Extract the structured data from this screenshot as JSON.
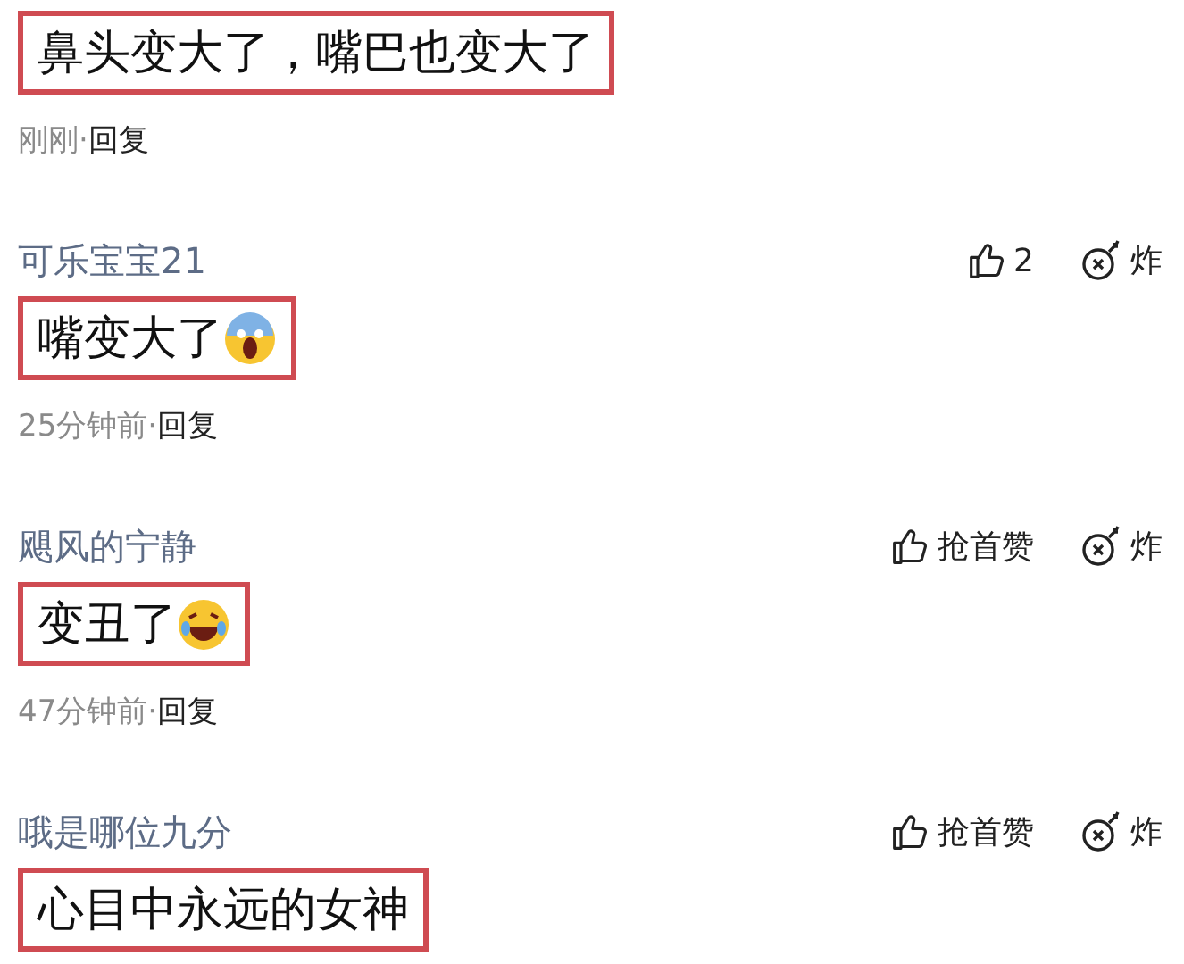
{
  "comments": [
    {
      "text": "鼻头变大了，嘴巴也变大了",
      "highlighted": true,
      "time": "刚刚",
      "separator": "·",
      "reply": "回复"
    },
    {
      "username": "可乐宝宝21",
      "like": "2",
      "bury": "炸",
      "text": "嘴变大了",
      "emoji": {
        "kind": "scream"
      },
      "highlighted": true,
      "time": "25分钟前",
      "separator": "·",
      "reply": "回复"
    },
    {
      "username": "飓风的宁静",
      "like": "抢首赞",
      "bury": "炸",
      "text": "变丑了",
      "emoji": {
        "kind": "laugh"
      },
      "highlighted": true,
      "time": "47分钟前",
      "separator": "·",
      "reply": "回复"
    },
    {
      "username": "哦是哪位九分",
      "like": "抢首赞",
      "bury": "炸",
      "text": "心目中永远的女神",
      "highlighted": true
    }
  ]
}
